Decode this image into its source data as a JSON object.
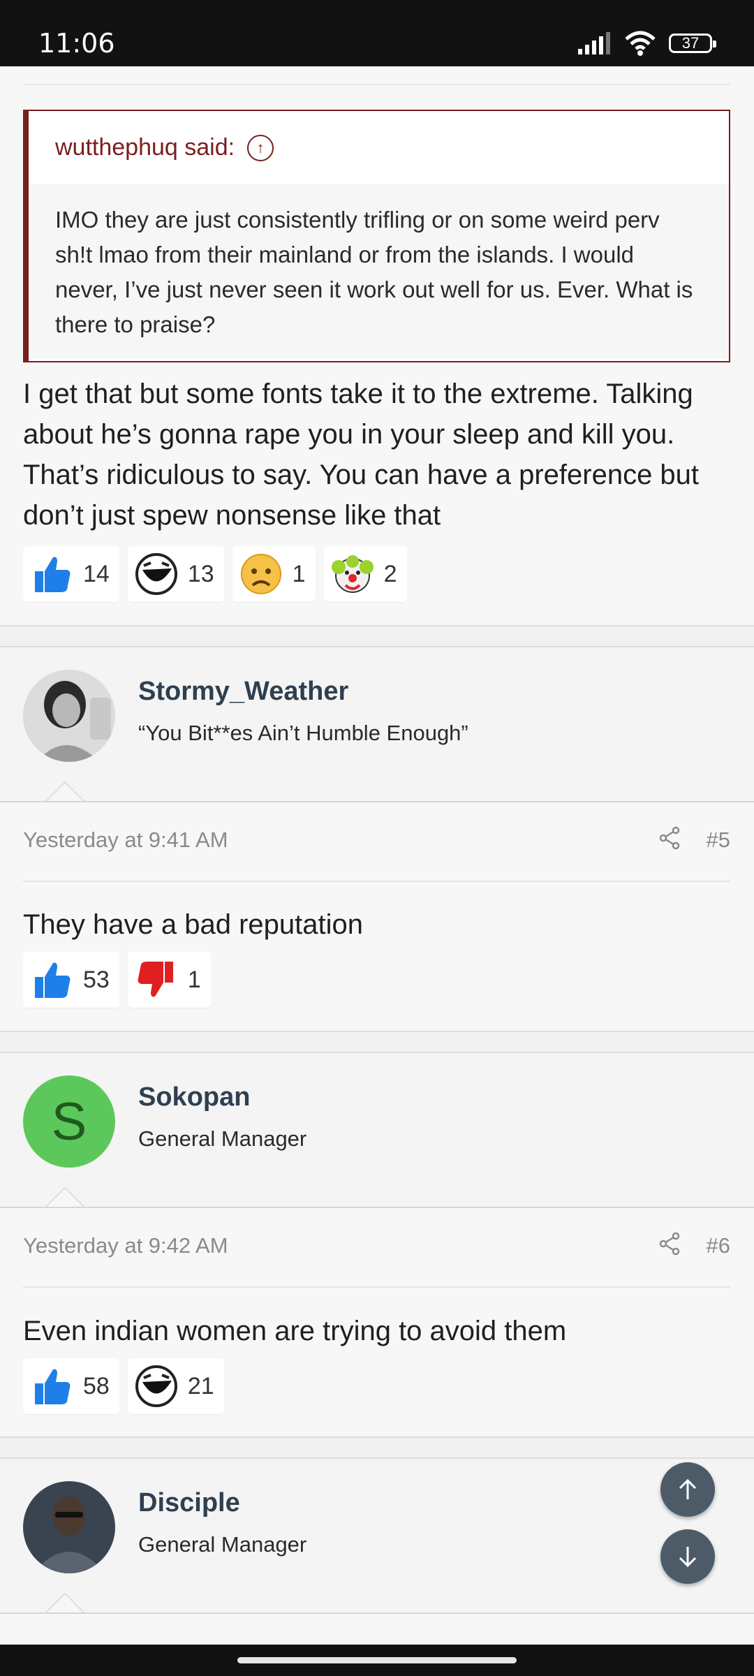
{
  "status_bar": {
    "time": "11:06",
    "battery": "37"
  },
  "quote": {
    "author_line": "wutthephuq said:",
    "text": "IMO they are just consistently trifling or on some weird perv sh!t lmao from their mainland or from the islands. I would never, I’ve just never seen it work out well for us. Ever. What is there to praise?"
  },
  "post4": {
    "text": "I get that but some fonts take it to the extreme. Talking about he’s gonna rape you in your sleep and kill you. That’s ridiculous to say. You can have a preference but don’t just spew nonsense like that",
    "reactions": [
      {
        "icon": "thumbs-up-icon",
        "count": "14"
      },
      {
        "icon": "laughing-face-icon",
        "count": "13"
      },
      {
        "icon": "sad-face-icon",
        "count": "1"
      },
      {
        "icon": "clown-face-icon",
        "count": "2"
      }
    ]
  },
  "post5": {
    "username": "Stormy_Weather",
    "user_title": "“You Bit**es Ain’t Humble Enough”",
    "date": "Yesterday at 9:41 AM",
    "number": "#5",
    "text": "They have a bad reputation",
    "reactions": [
      {
        "icon": "thumbs-up-icon",
        "count": "53"
      },
      {
        "icon": "thumbs-down-icon",
        "count": "1"
      }
    ]
  },
  "post6": {
    "username": "Sokopan",
    "avatar_letter": "S",
    "avatar_color": "#5cc85c",
    "user_title": "General Manager",
    "date": "Yesterday at 9:42 AM",
    "number": "#6",
    "text": "Even indian women are trying to avoid them",
    "reactions": [
      {
        "icon": "thumbs-up-icon",
        "count": "58"
      },
      {
        "icon": "laughing-face-icon",
        "count": "21"
      }
    ]
  },
  "post7": {
    "username": "Disciple",
    "user_title": "General Manager"
  },
  "colors": {
    "accent_quote": "#7a1f1f",
    "username": "#2f3f50",
    "like_blue": "#1e7fe8",
    "dislike_red": "#e02020",
    "fab": "#4d5b69"
  }
}
